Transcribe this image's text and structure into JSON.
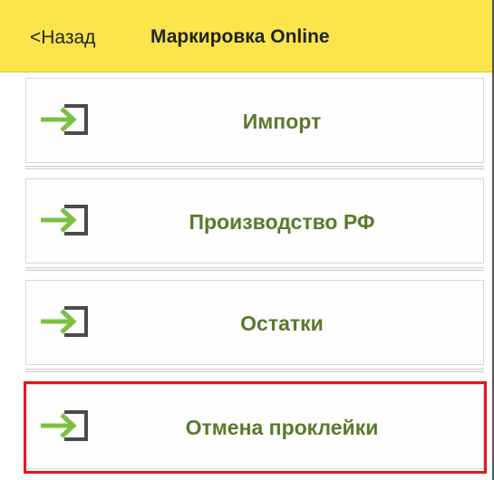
{
  "header": {
    "back_label": "<Назад",
    "title": "Маркировка Online",
    "background_color": "#fbe54a"
  },
  "menu": {
    "items": [
      {
        "label": "Импорт",
        "icon": "sign-in-icon"
      },
      {
        "label": "Производство РФ",
        "icon": "sign-in-icon"
      },
      {
        "label": "Остатки",
        "icon": "sign-in-icon"
      },
      {
        "label": "Отмена проклейки",
        "icon": "sign-in-icon",
        "highlighted": true
      }
    ],
    "label_color": "#5a7a2a",
    "icon_arrow_color": "#7cc043",
    "highlight_color": "#e8141a"
  }
}
